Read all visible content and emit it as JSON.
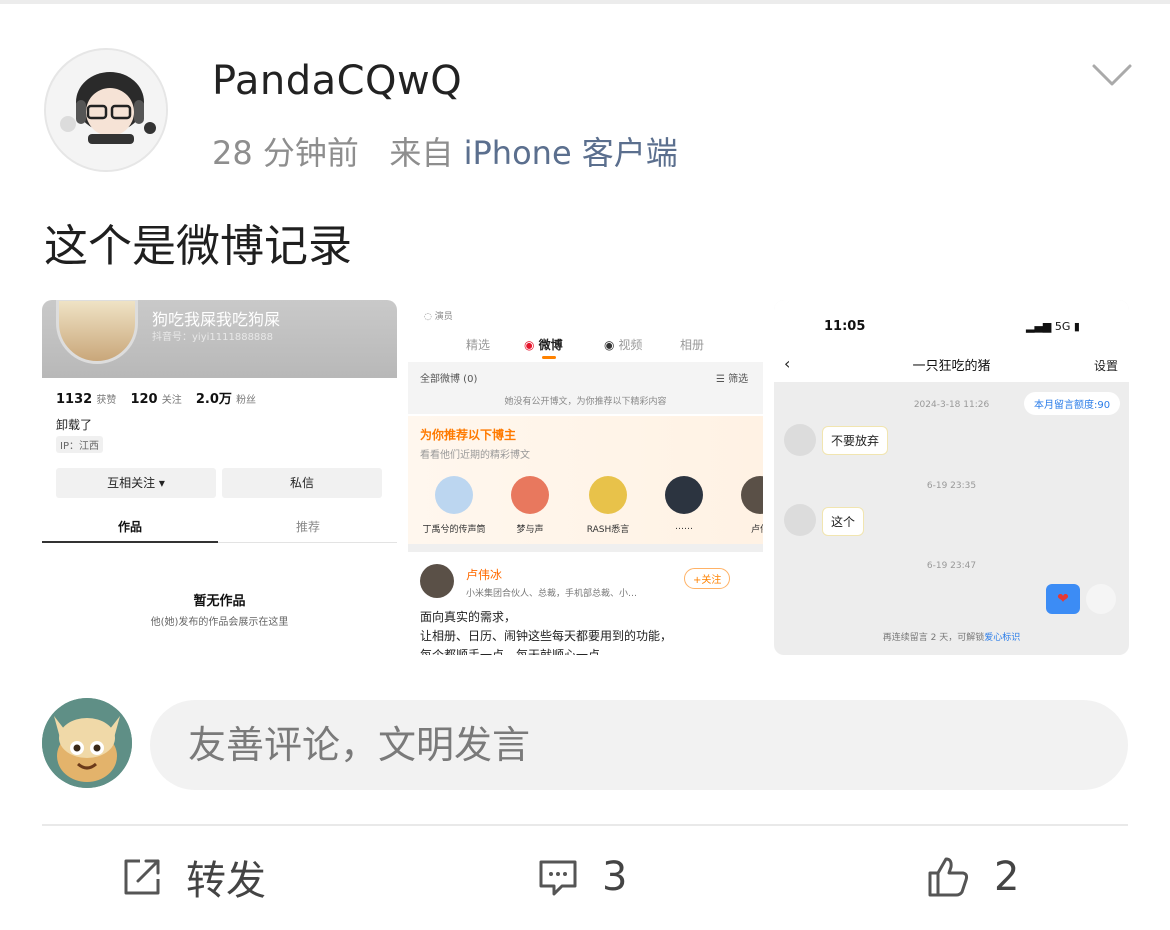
{
  "post": {
    "username": "PandaCQwQ",
    "time": "28 分钟前",
    "from_label": "来自",
    "source": "iPhone 客户端",
    "text": "这个是微博记录"
  },
  "images": {
    "profile": {
      "name": "狗吃我屎我吃狗屎",
      "id": "抖音号：yiyi1111888888",
      "likes_num": "1132",
      "likes_label": "获赞",
      "following_num": "120",
      "following_label": "关注",
      "fans_num": "2.0万",
      "fans_label": "粉丝",
      "bio": "卸载了",
      "ip": "IP：江西",
      "mutual_button": "互相关注 ▾",
      "message_button": "私信",
      "tab_works": "作品",
      "tab_recommend": "推荐",
      "empty_title": "暂无作品",
      "empty_sub": "他(她)发布的作品会展示在这里"
    },
    "weibo": {
      "role": "演员",
      "tabs": [
        "精选",
        "微博",
        "视频",
        "相册"
      ],
      "all_weibo": "全部微博 (0)",
      "filter": "筛选",
      "no_public": "她没有公开博文，为你推荐以下精彩内容",
      "rec_title": "为你推荐以下博主",
      "rec_sub": "看看他们近期的精彩博文",
      "bloggers": [
        {
          "name": "丁禹兮的传声筒",
          "color": "#bcd6f0"
        },
        {
          "name": "梦与声",
          "color": "#e8785e"
        },
        {
          "name": "RASH悉言",
          "color": "#e8c24a"
        },
        {
          "name": "……",
          "color": "#2c3440"
        },
        {
          "name": "卢伟",
          "color": "#5a5047"
        }
      ],
      "poster_name": "卢伟冰",
      "poster_desc": "小米集团合伙人、总裁，手机部总裁、小…",
      "follow_button": "+关注",
      "content": [
        "面向真实的需求，",
        "让相册、日历、闹钟这些每天都要用到的功能，",
        "每个都顺手一点，每天就顺心一点"
      ]
    },
    "chat": {
      "time": "11:05",
      "network": "5G",
      "title": "一只狂吃的猪",
      "settings": "设置",
      "quota": "本月留言额度:90",
      "messages": [
        {
          "timestamp": "2024-3-18 11:26",
          "text": "不要放弃"
        },
        {
          "timestamp": "6-19 23:35",
          "text": "这个"
        },
        {
          "timestamp": "6-19 23:47",
          "text": "❤"
        }
      ],
      "footer_prefix": "再连续留言 2 天，可解锁",
      "footer_link": "爱心标识"
    }
  },
  "comment": {
    "placeholder": "友善评论，文明发言"
  },
  "actions": {
    "repost_label": "转发",
    "comment_count": "3",
    "like_count": "2"
  },
  "icons": [
    "chevron-down-icon",
    "repost-icon",
    "comment-icon",
    "thumbs-up-icon"
  ]
}
